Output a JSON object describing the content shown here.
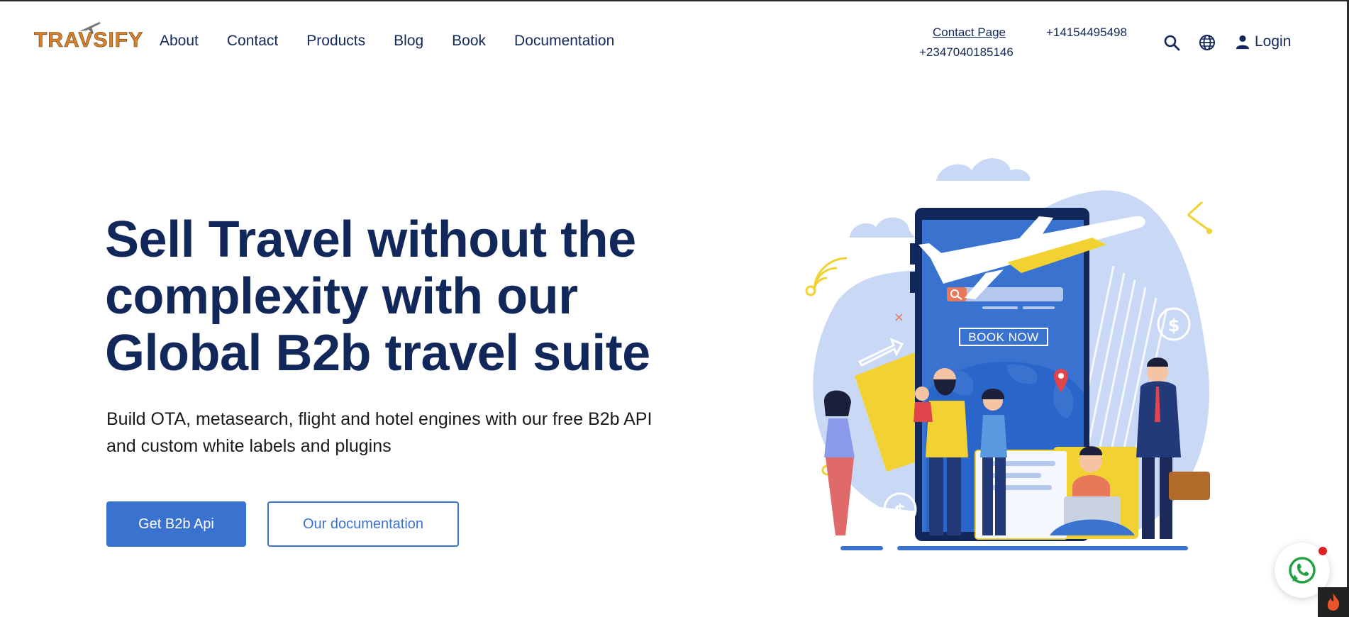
{
  "brand": {
    "logo_text": "TRAVSIFY"
  },
  "nav": {
    "items": [
      {
        "label": "About"
      },
      {
        "label": "Contact"
      },
      {
        "label": "Products"
      },
      {
        "label": "Blog"
      },
      {
        "label": "Book"
      },
      {
        "label": "Documentation"
      }
    ]
  },
  "header": {
    "contact_link": "Contact Page",
    "phone_primary": "+14154495498",
    "phone_secondary": "+2347040185146",
    "login_label": "Login",
    "icons": [
      "search-icon",
      "globe-icon",
      "user-icon"
    ]
  },
  "hero": {
    "title": "Sell Travel without the complexity with our Global B2b travel suite",
    "subtitle": "Build OTA, metasearch, flight and hotel engines with our free B2b API and custom white labels and plugins",
    "primary_button": "Get B2b Api",
    "secondary_button": "Our documentation"
  },
  "illustration": {
    "book_now_label": "BOOK NOW",
    "currency_symbol": "$"
  },
  "widgets": {
    "whatsapp_icon": "whatsapp-icon",
    "fire_icon": "fire-icon"
  },
  "colors": {
    "navy": "#13285a",
    "accent_blue": "#3a73cf",
    "logo_orange": "#d9822b"
  }
}
